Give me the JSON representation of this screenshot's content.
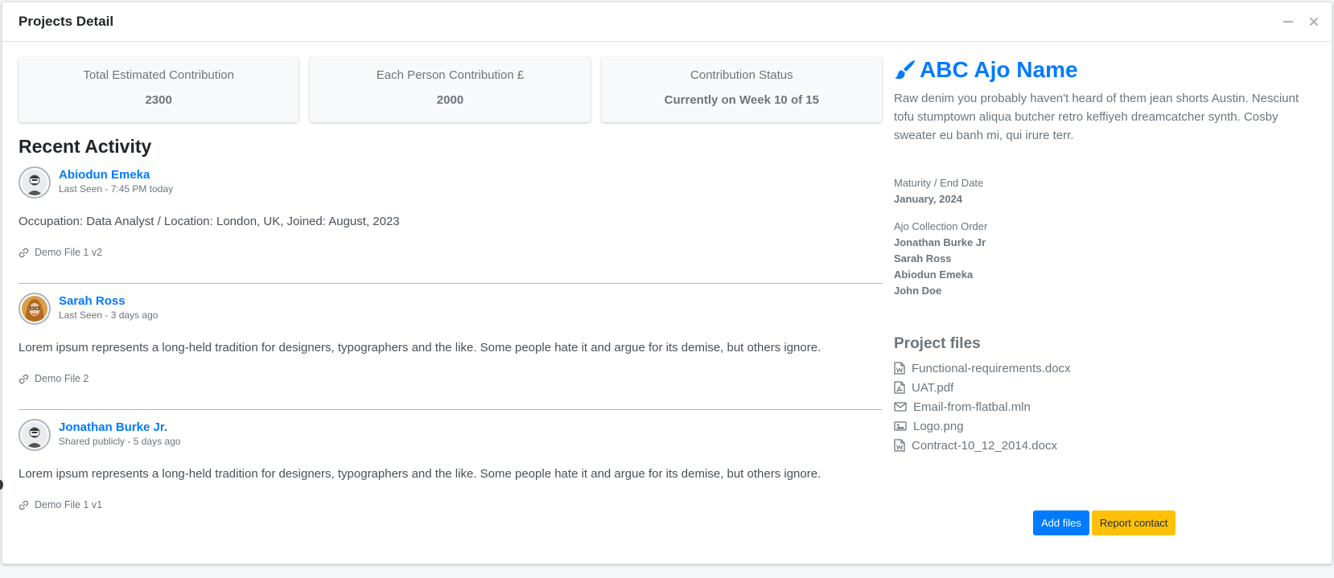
{
  "window": {
    "title": "Projects Detail"
  },
  "stats": [
    {
      "label": "Total Estimated Contribution",
      "value": "2300"
    },
    {
      "label": "Each Person Contribution £",
      "value": "2000"
    },
    {
      "label": "Contribution Status",
      "value": "Currently on Week 10 of 15"
    }
  ],
  "recent": {
    "title": "Recent Activity",
    "posts": [
      {
        "user": "Abiodun Emeka",
        "meta": "Last Seen - 7:45 PM today",
        "text": "Occupation: Data Analyst / Location: London, UK, Joined: August, 2023",
        "link": "Demo File 1 v2"
      },
      {
        "user": "Sarah Ross",
        "meta": "Last Seen - 3 days ago",
        "text": "Lorem ipsum represents a long-held tradition for designers, typographers and the like. Some people hate it and argue for its demise, but others ignore.",
        "link": "Demo File 2"
      },
      {
        "user": "Jonathan Burke Jr.",
        "meta": "Shared publicly - 5 days ago",
        "text": "Lorem ipsum represents a long-held tradition for designers, typographers and the like. Some people hate it and argue for its demise, but others ignore.",
        "link": "Demo File 1 v1"
      }
    ]
  },
  "project": {
    "name": "ABC Ajo Name",
    "description": "Raw denim you probably haven't heard of them jean shorts Austin. Nesciunt tofu stumptown aliqua butcher retro keffiyeh dreamcatcher synth. Cosby sweater eu banh mi, qui irure terr.",
    "maturity_label": "Maturity / End Date",
    "maturity_value": "January, 2024",
    "order_label": "Ajo Collection Order",
    "order": [
      "Jonathan Burke Jr",
      "Sarah Ross",
      "Abiodun Emeka",
      "John Doe"
    ],
    "files_title": "Project files",
    "files": [
      {
        "name": "Functional-requirements.docx",
        "icon": "word-file-icon"
      },
      {
        "name": "UAT.pdf",
        "icon": "pdf-file-icon"
      },
      {
        "name": "Email-from-flatbal.mln",
        "icon": "envelope-icon"
      },
      {
        "name": "Logo.png",
        "icon": "image-file-icon"
      },
      {
        "name": "Contract-10_12_2014.docx",
        "icon": "word-file-icon"
      }
    ],
    "add_files_label": "Add files",
    "report_contact_label": "Report contact"
  },
  "colors": {
    "accent": "#007bff",
    "warning": "#ffc107",
    "muted": "#6c757d"
  }
}
